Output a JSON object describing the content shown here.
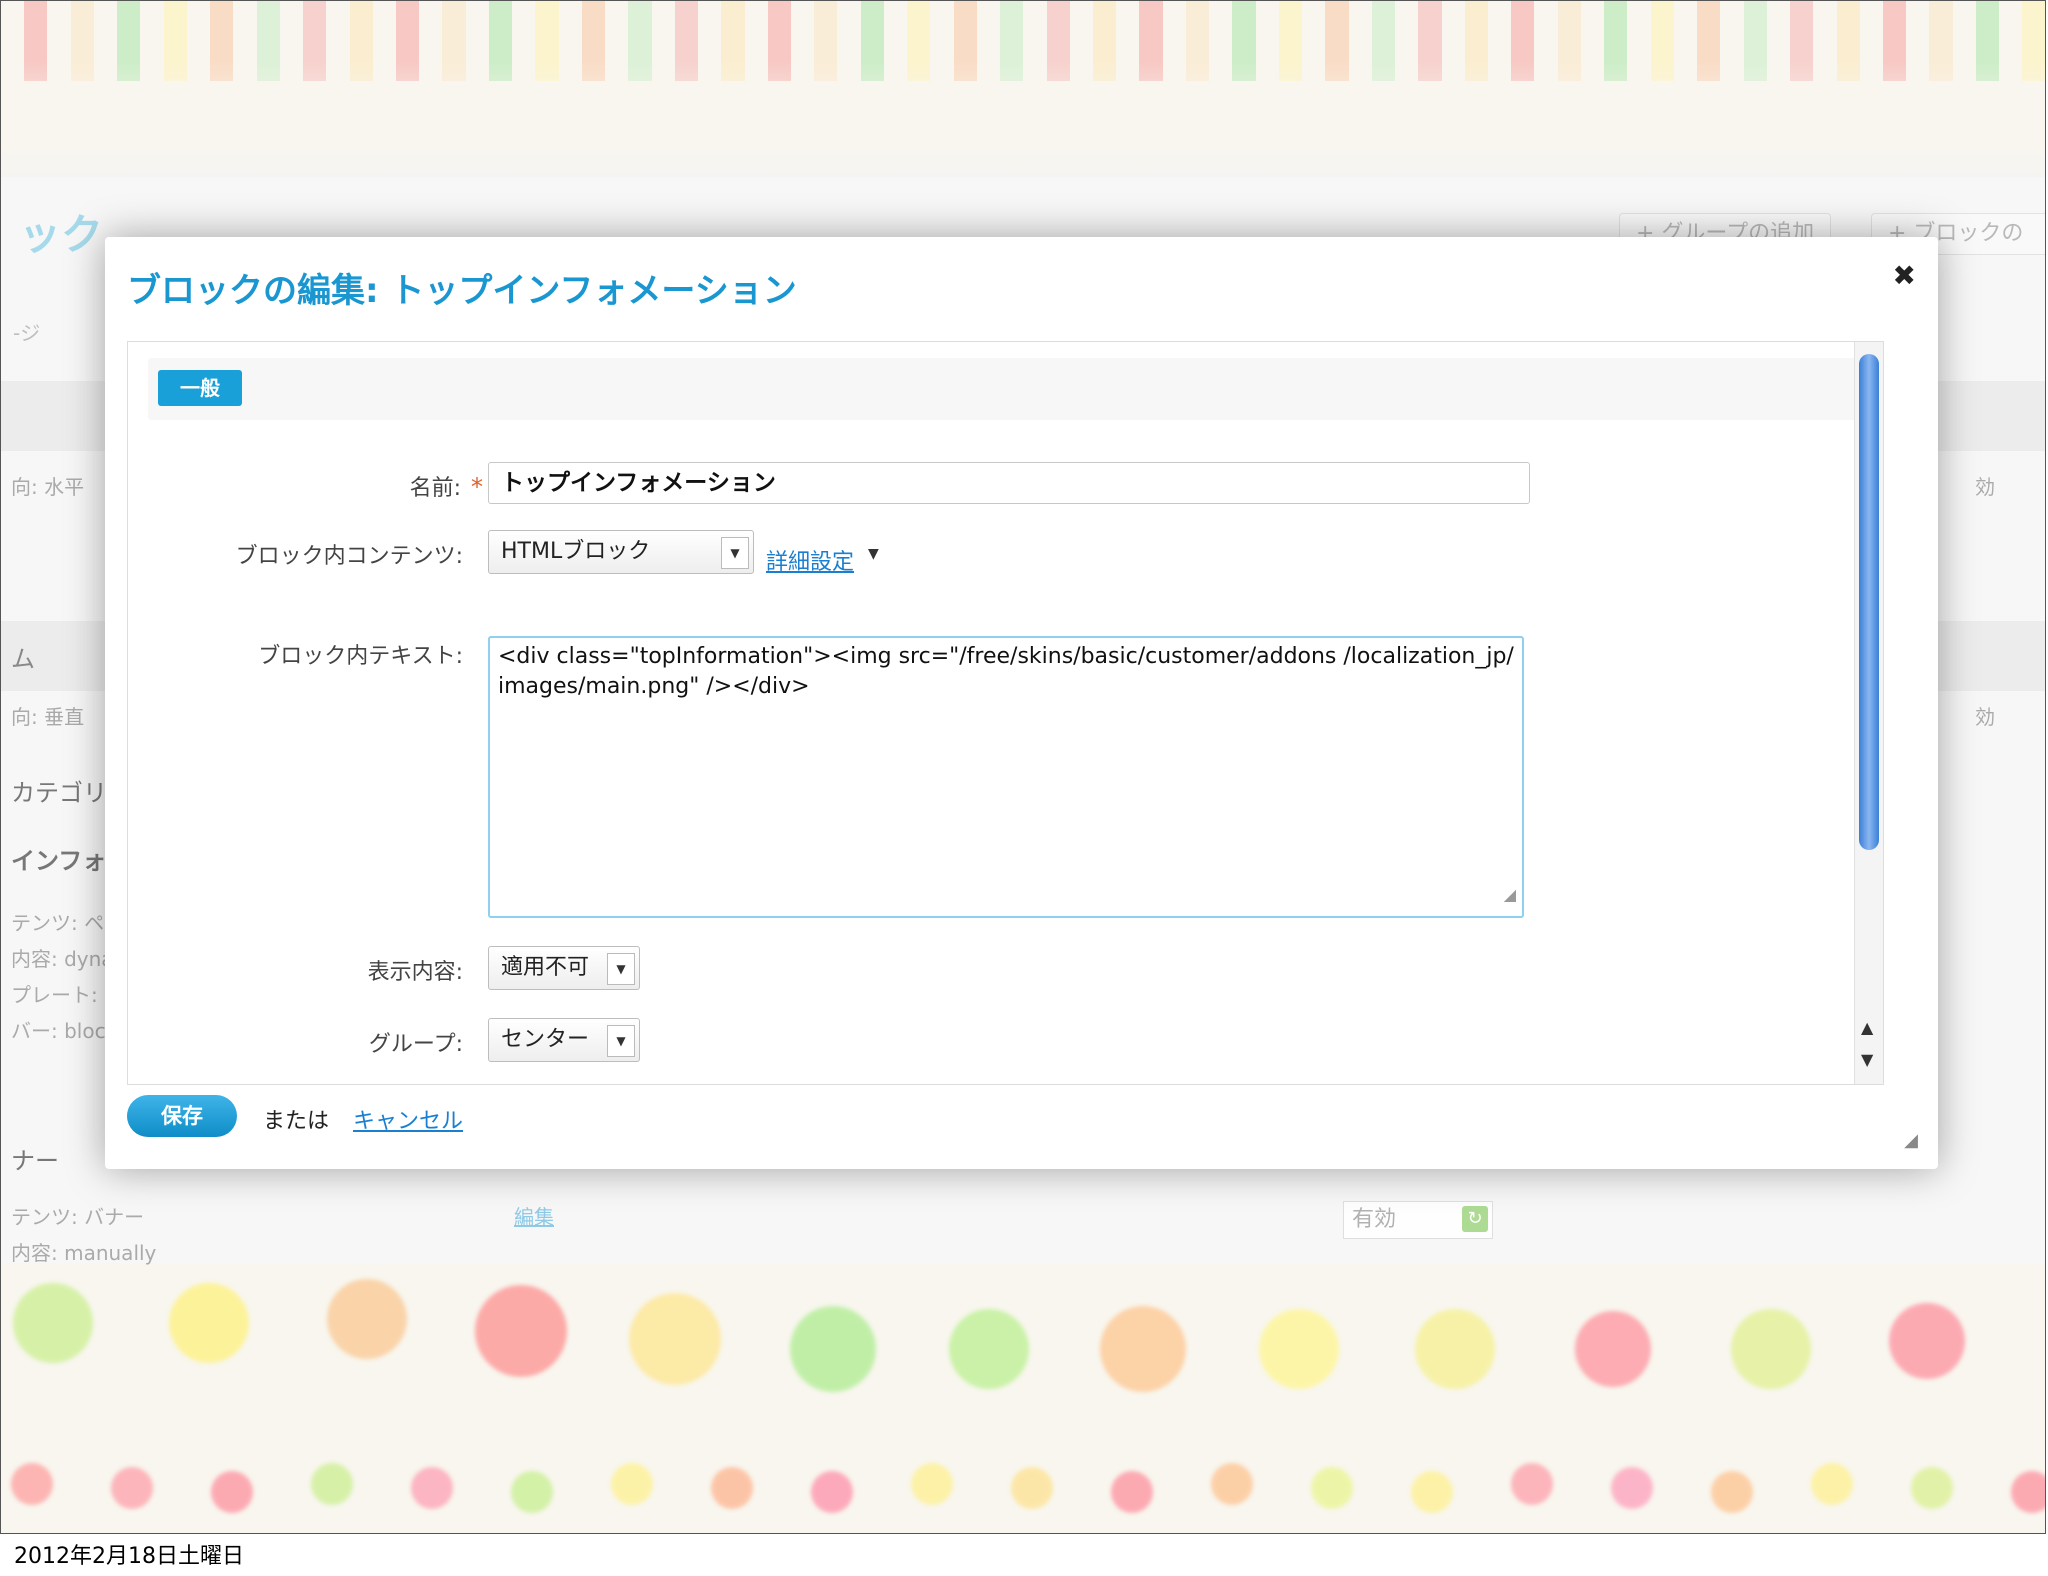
{
  "background": {
    "title_fragment": "ック",
    "tab_fragment": "-ジ",
    "buttons": [
      "+ グループの追加",
      "+ ブロックの"
    ],
    "left_items": [
      "向: 水平",
      "ム",
      "向: 垂直",
      "カテゴリー",
      "インフォメ",
      "テンツ: ペ",
      "内容: dyna",
      "プレート:",
      "バー: block",
      "ナー",
      "テンツ: バナー",
      "内容: manually"
    ],
    "right_items": [
      "効",
      "効"
    ],
    "edit_link": "編集",
    "status_value": "有効"
  },
  "dialog": {
    "title": "ブロックの編集: トップインフォメーション",
    "close_icon": "close-icon",
    "tab_general": "一般",
    "fields": {
      "name_label": "名前:",
      "name_required": "*",
      "name_value": "トップインフォメーション",
      "content_label": "ブロック内コンテンツ:",
      "content_value": "HTMLブロック",
      "advanced_link": "詳細設定",
      "text_label": "ブロック内テキスト:",
      "text_value": "<div class=\"topInformation\"><img src=\"/free/skins/basic/customer/addons /localization_jp/images/main.png\" /></div>",
      "display_label": "表示内容:",
      "display_value": "適用不可",
      "group_label": "グループ:",
      "group_value": "センター"
    },
    "actions": {
      "save": "保存",
      "or": "または",
      "cancel": "キャンセル"
    }
  },
  "footer": {
    "date": "2012年2月18日土曜日"
  }
}
